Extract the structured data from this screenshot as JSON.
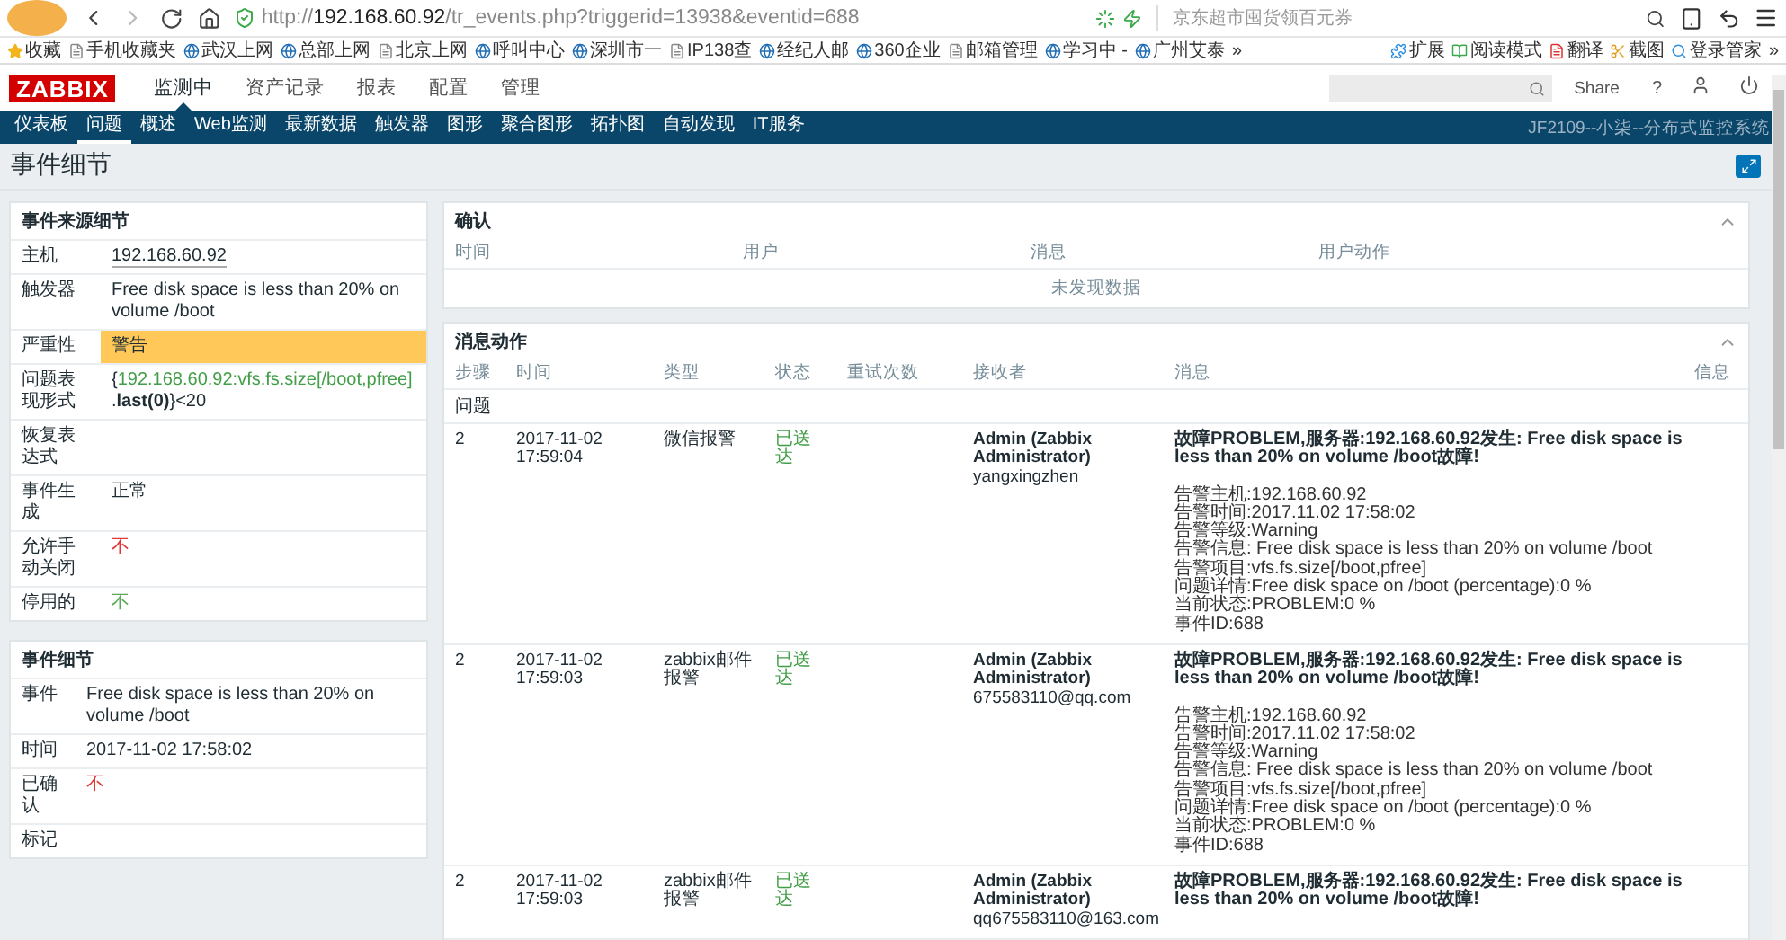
{
  "browser": {
    "url_scheme": "http://",
    "url_host": "192.168.60.92",
    "url_path": "/tr_events.php?triggerid=13938&eventid=688",
    "search_placeholder": "京东超市囤货领百元券",
    "bookmarks": [
      {
        "label": "收藏"
      },
      {
        "label": "手机收藏夹"
      },
      {
        "label": "武汉上网"
      },
      {
        "label": "总部上网"
      },
      {
        "label": "北京上网"
      },
      {
        "label": "呼叫中心"
      },
      {
        "label": "深圳市一"
      },
      {
        "label": "IP138查"
      },
      {
        "label": "经纪人邮"
      },
      {
        "label": "360企业"
      },
      {
        "label": "邮箱管理"
      },
      {
        "label": "学习中 -"
      },
      {
        "label": "广州艾泰"
      }
    ],
    "bookmarks_more": "»",
    "tools": [
      {
        "label": "扩展"
      },
      {
        "label": "阅读模式"
      },
      {
        "label": "翻译"
      },
      {
        "label": "截图"
      },
      {
        "label": "登录管家"
      }
    ],
    "tools_more": "»"
  },
  "header": {
    "logo": "ZABBIX",
    "menu": [
      {
        "label": "监测中",
        "selected": true
      },
      {
        "label": "资产记录",
        "selected": false
      },
      {
        "label": "报表",
        "selected": false
      },
      {
        "label": "配置",
        "selected": false
      },
      {
        "label": "管理",
        "selected": false
      }
    ],
    "share": "Share",
    "help": "?",
    "subnav": [
      {
        "label": "仪表板",
        "selected": false
      },
      {
        "label": "问题",
        "selected": true
      },
      {
        "label": "概述",
        "selected": false
      },
      {
        "label": "Web监测",
        "selected": false
      },
      {
        "label": "最新数据",
        "selected": false
      },
      {
        "label": "触发器",
        "selected": false
      },
      {
        "label": "图形",
        "selected": false
      },
      {
        "label": "聚合图形",
        "selected": false
      },
      {
        "label": "拓扑图",
        "selected": false
      },
      {
        "label": "自动发现",
        "selected": false
      },
      {
        "label": "IT服务",
        "selected": false
      }
    ],
    "system_name": "JF2109--小柒--分布式监控系统"
  },
  "page_title": "事件细节",
  "source_details": {
    "title": "事件来源细节",
    "rows": [
      {
        "label": "主机",
        "kind": "link",
        "value": "192.168.60.92"
      },
      {
        "label": "触发器",
        "kind": "text",
        "value": "Free disk space is less than 20% on volume /boot"
      },
      {
        "label": "严重性",
        "kind": "severity",
        "value": "警告",
        "color": "#ffc859"
      },
      {
        "label": "问题表现形式",
        "kind": "expression",
        "prefix": "{",
        "item": "192.168.60.92:vfs.fs.size[/boot,pfree]",
        "suffix": ".**last(0)**}<20"
      },
      {
        "label": "恢复表达式",
        "kind": "text",
        "value": ""
      },
      {
        "label": "事件生成",
        "kind": "text",
        "value": "正常"
      },
      {
        "label": "允许手动关闭",
        "kind": "flag",
        "value": "不",
        "color": "#e33734"
      },
      {
        "label": "停用的",
        "kind": "flag",
        "value": "不",
        "color": "#59a959"
      }
    ]
  },
  "event_details": {
    "title": "事件细节",
    "rows": [
      {
        "label": "事件",
        "kind": "text",
        "value": "Free disk space is less than 20% on volume /boot"
      },
      {
        "label": "时间",
        "kind": "text",
        "value": "2017-11-02 17:58:02"
      },
      {
        "label": "已确认",
        "kind": "flag",
        "value": "不",
        "color": "#e33734"
      },
      {
        "label": "标记",
        "kind": "text",
        "value": ""
      }
    ]
  },
  "acknowledgements": {
    "title": "确认",
    "columns": [
      "时间",
      "用户",
      "消息",
      "用户动作"
    ],
    "empty": "未发现数据"
  },
  "message_actions": {
    "title": "消息动作",
    "columns": [
      "步骤",
      "时间",
      "类型",
      "状态",
      "重试次数",
      "接收者",
      "消息",
      "信息"
    ],
    "section": "问题",
    "rows": [
      {
        "step": "2",
        "time": "2017-11-02 17:59:04",
        "type": "微信报警",
        "status": "已送达",
        "recipient": "Admin (Zabbix Administrator)",
        "address": "yangxingzhen",
        "subject": "故障PROBLEM,服务器:192.168.60.92发生: Free disk space is less than 20% on volume /boot故障!",
        "body": [
          "告警主机:192.168.60.92",
          "告警时间:2017.11.02 17:58:02",
          "告警等级:Warning",
          "告警信息: Free disk space is less than 20% on volume /boot",
          "告警项目:vfs.fs.size[/boot,pfree]",
          "问题详情:Free disk space on /boot (percentage):0 %",
          "当前状态:PROBLEM:0 %",
          "事件ID:688"
        ]
      },
      {
        "step": "2",
        "time": "2017-11-02 17:59:03",
        "type": "zabbix邮件报警",
        "status": "已送达",
        "recipient": "Admin (Zabbix Administrator)",
        "address": "675583110@qq.com",
        "subject": "故障PROBLEM,服务器:192.168.60.92发生: Free disk space is less than 20% on volume /boot故障!",
        "body": [
          "告警主机:192.168.60.92",
          "告警时间:2017.11.02 17:58:02",
          "告警等级:Warning",
          "告警信息: Free disk space is less than 20% on volume /boot",
          "告警项目:vfs.fs.size[/boot,pfree]",
          "问题详情:Free disk space on /boot (percentage):0 %",
          "当前状态:PROBLEM:0 %",
          "事件ID:688"
        ]
      },
      {
        "step": "2",
        "time": "2017-11-02 17:59:03",
        "type": "zabbix邮件报警",
        "status": "已送达",
        "recipient": "Admin (Zabbix Administrator)",
        "address": "qq675583110@163.com",
        "subject": "故障PROBLEM,服务器:192.168.60.92发生: Free disk space is less than 20% on volume /boot故障!",
        "body": []
      }
    ]
  }
}
